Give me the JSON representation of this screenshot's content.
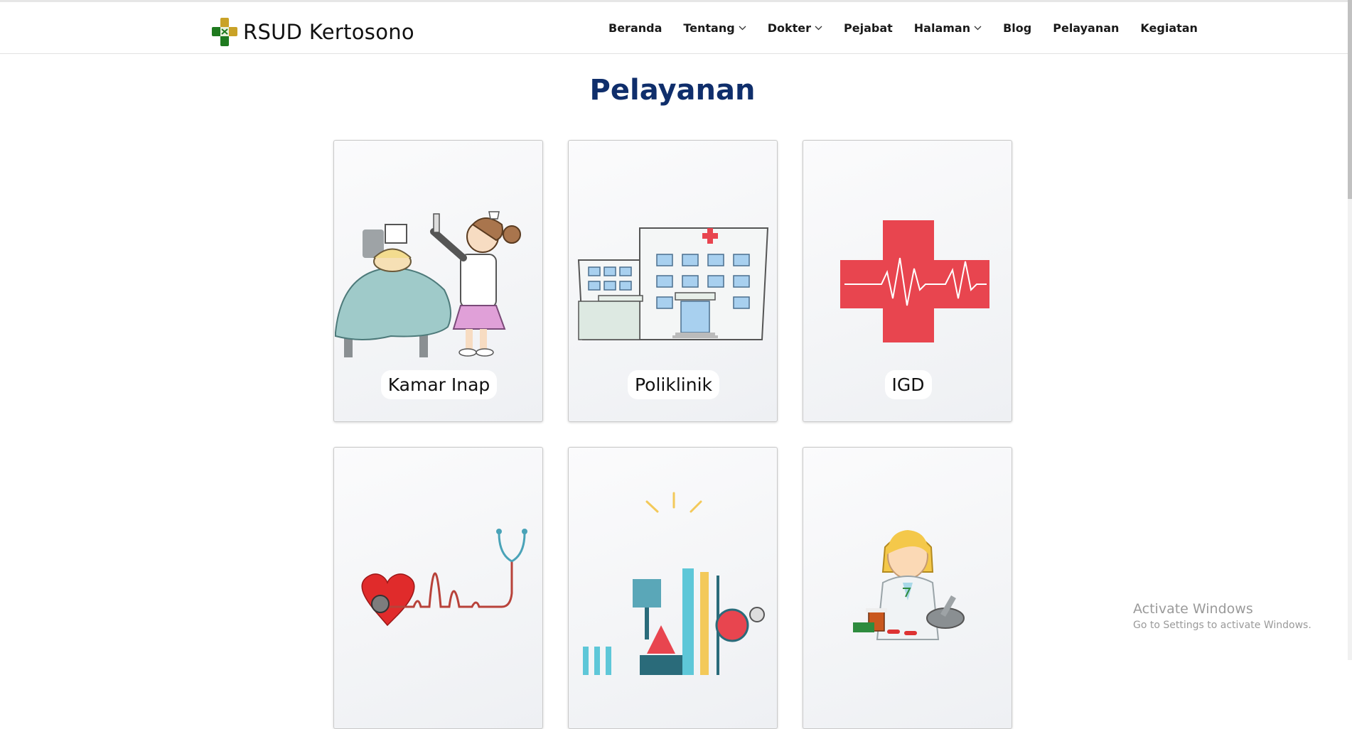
{
  "brand": {
    "name": "RSUD Kertosono"
  },
  "nav": {
    "items": [
      {
        "label": "Beranda"
      },
      {
        "label": "Tentang"
      },
      {
        "label": "Dokter"
      },
      {
        "label": "Pejabat"
      },
      {
        "label": "Halaman"
      },
      {
        "label": "Blog"
      },
      {
        "label": "Pelayanan"
      },
      {
        "label": "Kegiatan"
      }
    ]
  },
  "page": {
    "title": "Pelayanan"
  },
  "services": [
    {
      "label": "Kamar Inap",
      "icon": "inpatient-nurse-icon"
    },
    {
      "label": "Poliklinik",
      "icon": "hospital-building-icon"
    },
    {
      "label": "IGD",
      "icon": "red-cross-heartbeat-icon"
    },
    {
      "label": "",
      "icon": "heart-stethoscope-icon"
    },
    {
      "label": "",
      "icon": "laboratory-equipment-icon"
    },
    {
      "label": "",
      "icon": "pharmacist-icon"
    }
  ],
  "system_watermark": {
    "line1": "Activate Windows",
    "line2": "Go to Settings to activate Windows."
  },
  "colors": {
    "title": "#0f2e6b",
    "logo_green": "#1f7a1f",
    "logo_gold": "#c9a227",
    "red_cross": "#e8454f"
  }
}
